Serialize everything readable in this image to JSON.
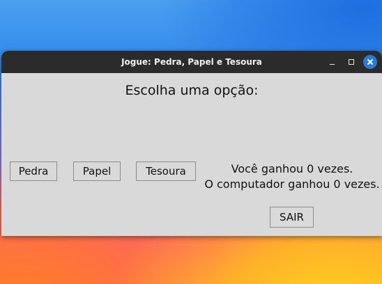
{
  "window": {
    "title": "Jogue: Pedra, Papel e Tesoura",
    "controls": [
      "minimize",
      "maximize",
      "close"
    ]
  },
  "main": {
    "heading": "Escolha uma opção:",
    "choices": [
      {
        "label": "Pedra"
      },
      {
        "label": "Papel"
      },
      {
        "label": "Tesoura"
      }
    ],
    "score": {
      "user_text": "Você ganhou 0 vezes.",
      "computer_text": "O computador ganhou 0 vezes."
    },
    "exit_label": "SAIR"
  },
  "colors": {
    "titlebar": "#2b2b2b",
    "window_bg": "#d9d9d9",
    "close_button": "#2a7bd8"
  }
}
